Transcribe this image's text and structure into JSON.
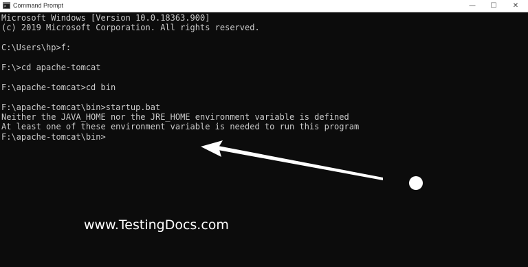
{
  "window": {
    "title": "Command Prompt",
    "controls": {
      "minimize": "—",
      "maximize": "☐",
      "close": "✕"
    }
  },
  "console": {
    "lines": [
      "Microsoft Windows [Version 10.0.18363.900]",
      "(c) 2019 Microsoft Corporation. All rights reserved.",
      "",
      "C:\\Users\\hp>f:",
      "",
      "F:\\>cd apache-tomcat",
      "",
      "F:\\apache-tomcat>cd bin",
      "",
      "F:\\apache-tomcat\\bin>startup.bat",
      "Neither the JAVA_HOME nor the JRE_HOME environment variable is defined",
      "At least one of these environment variable is needed to run this program",
      "F:\\apache-tomcat\\bin>"
    ]
  },
  "annotation": {
    "watermark": "www.TestingDocs.com"
  },
  "colors": {
    "console_bg": "#0c0c0c",
    "console_fg": "#cccccc",
    "titlebar_bg": "#ffffff",
    "annotation": "#ffffff"
  }
}
